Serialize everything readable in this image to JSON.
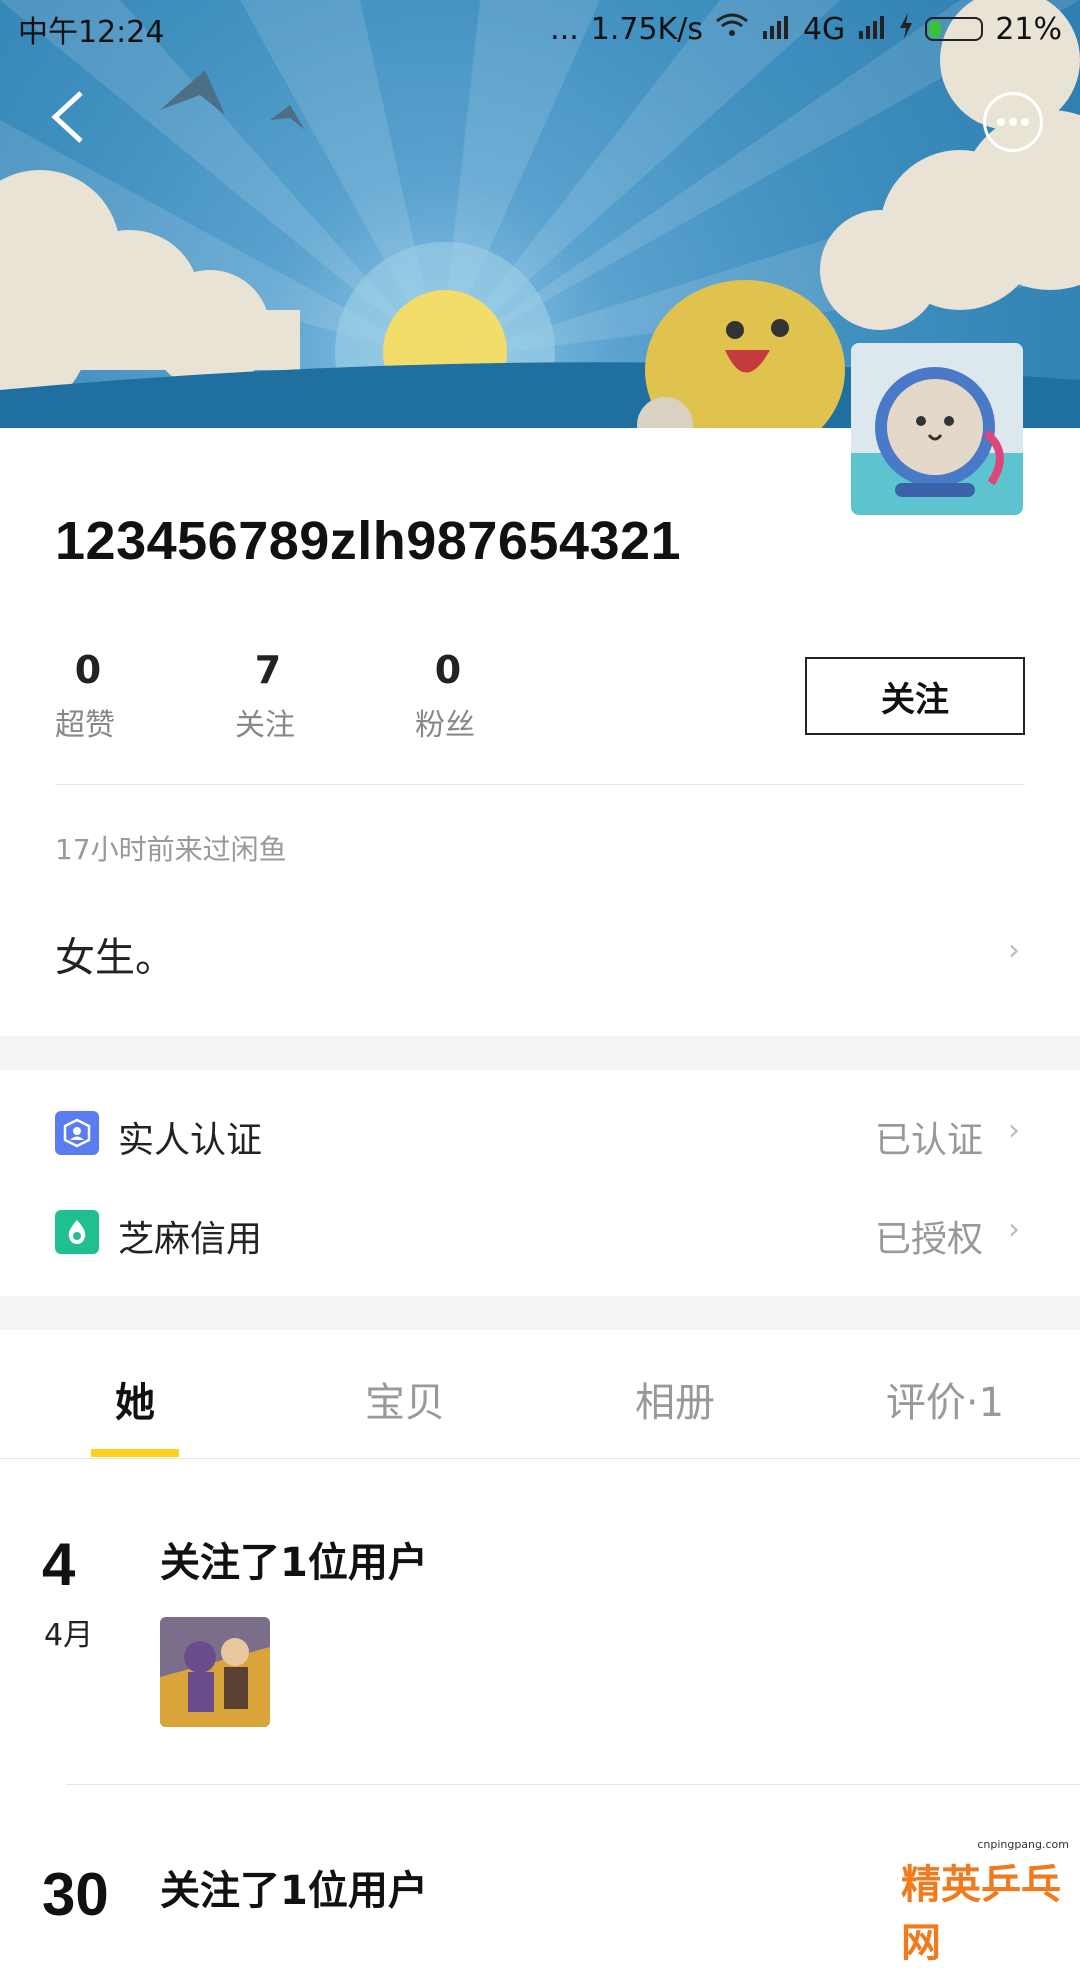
{
  "status_bar": {
    "time": "中午12:24",
    "dots": "...",
    "speed": "1.75K/s",
    "network": "4G",
    "battery": "21%"
  },
  "profile": {
    "username": "123456789zlh987654321",
    "stats": [
      {
        "value": "0",
        "label": "超赞"
      },
      {
        "value": "7",
        "label": "关注"
      },
      {
        "value": "0",
        "label": "粉丝"
      }
    ],
    "follow_label": "关注",
    "last_visit": "17小时前来过闲鱼",
    "bio": "女生。"
  },
  "verify": {
    "real_name_label": "实人认证",
    "real_name_status": "已认证",
    "sesame_label": "芝麻信用",
    "sesame_status": "已授权"
  },
  "tabs": [
    {
      "label": "她"
    },
    {
      "label": "宝贝"
    },
    {
      "label": "相册"
    },
    {
      "label": "评价·1"
    }
  ],
  "feed": [
    {
      "day": "4",
      "month": "4月",
      "title": "关注了1位用户"
    },
    {
      "day": "30",
      "title": "关注了1位用户"
    }
  ],
  "watermark": {
    "url": "cnpingpang.com",
    "text": "精英乒乓网"
  },
  "colors": {
    "tab_indicator": "#ffd21f",
    "real_name_icon": "#5b7cf0",
    "sesame_icon": "#1fbf8f"
  }
}
